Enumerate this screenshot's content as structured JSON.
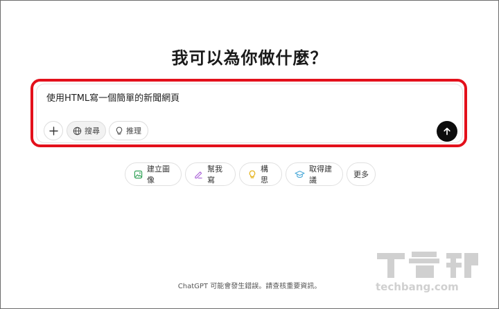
{
  "headline": "我可以為你做什麼？",
  "composer": {
    "prompt_text": "使用HTML寫一個簡單的新聞網頁",
    "tools": {
      "plus_icon": "plus-icon",
      "search_label": "搜尋",
      "search_icon": "globe-icon",
      "reason_label": "推理",
      "reason_icon": "lightbulb-icon"
    },
    "send_icon": "arrow-up-icon"
  },
  "suggestions": [
    {
      "label": "建立圖像",
      "icon": "image-icon",
      "color": "#35a35a"
    },
    {
      "label": "幫我寫",
      "icon": "pen-icon",
      "color": "#a85fd6"
    },
    {
      "label": "構思",
      "icon": "lightbulb-icon",
      "color": "#e5b21b"
    },
    {
      "label": "取得建議",
      "icon": "graduation-cap-icon",
      "color": "#4aa8d8"
    },
    {
      "label": "更多"
    }
  ],
  "footer": "ChatGPT 可能會發生錯誤。請查核重要資訊。",
  "watermark": {
    "brand": "T客邦",
    "domain": "techbang.com"
  },
  "colors": {
    "highlight": "#e3101b",
    "send_button": "#0d0d0d"
  }
}
